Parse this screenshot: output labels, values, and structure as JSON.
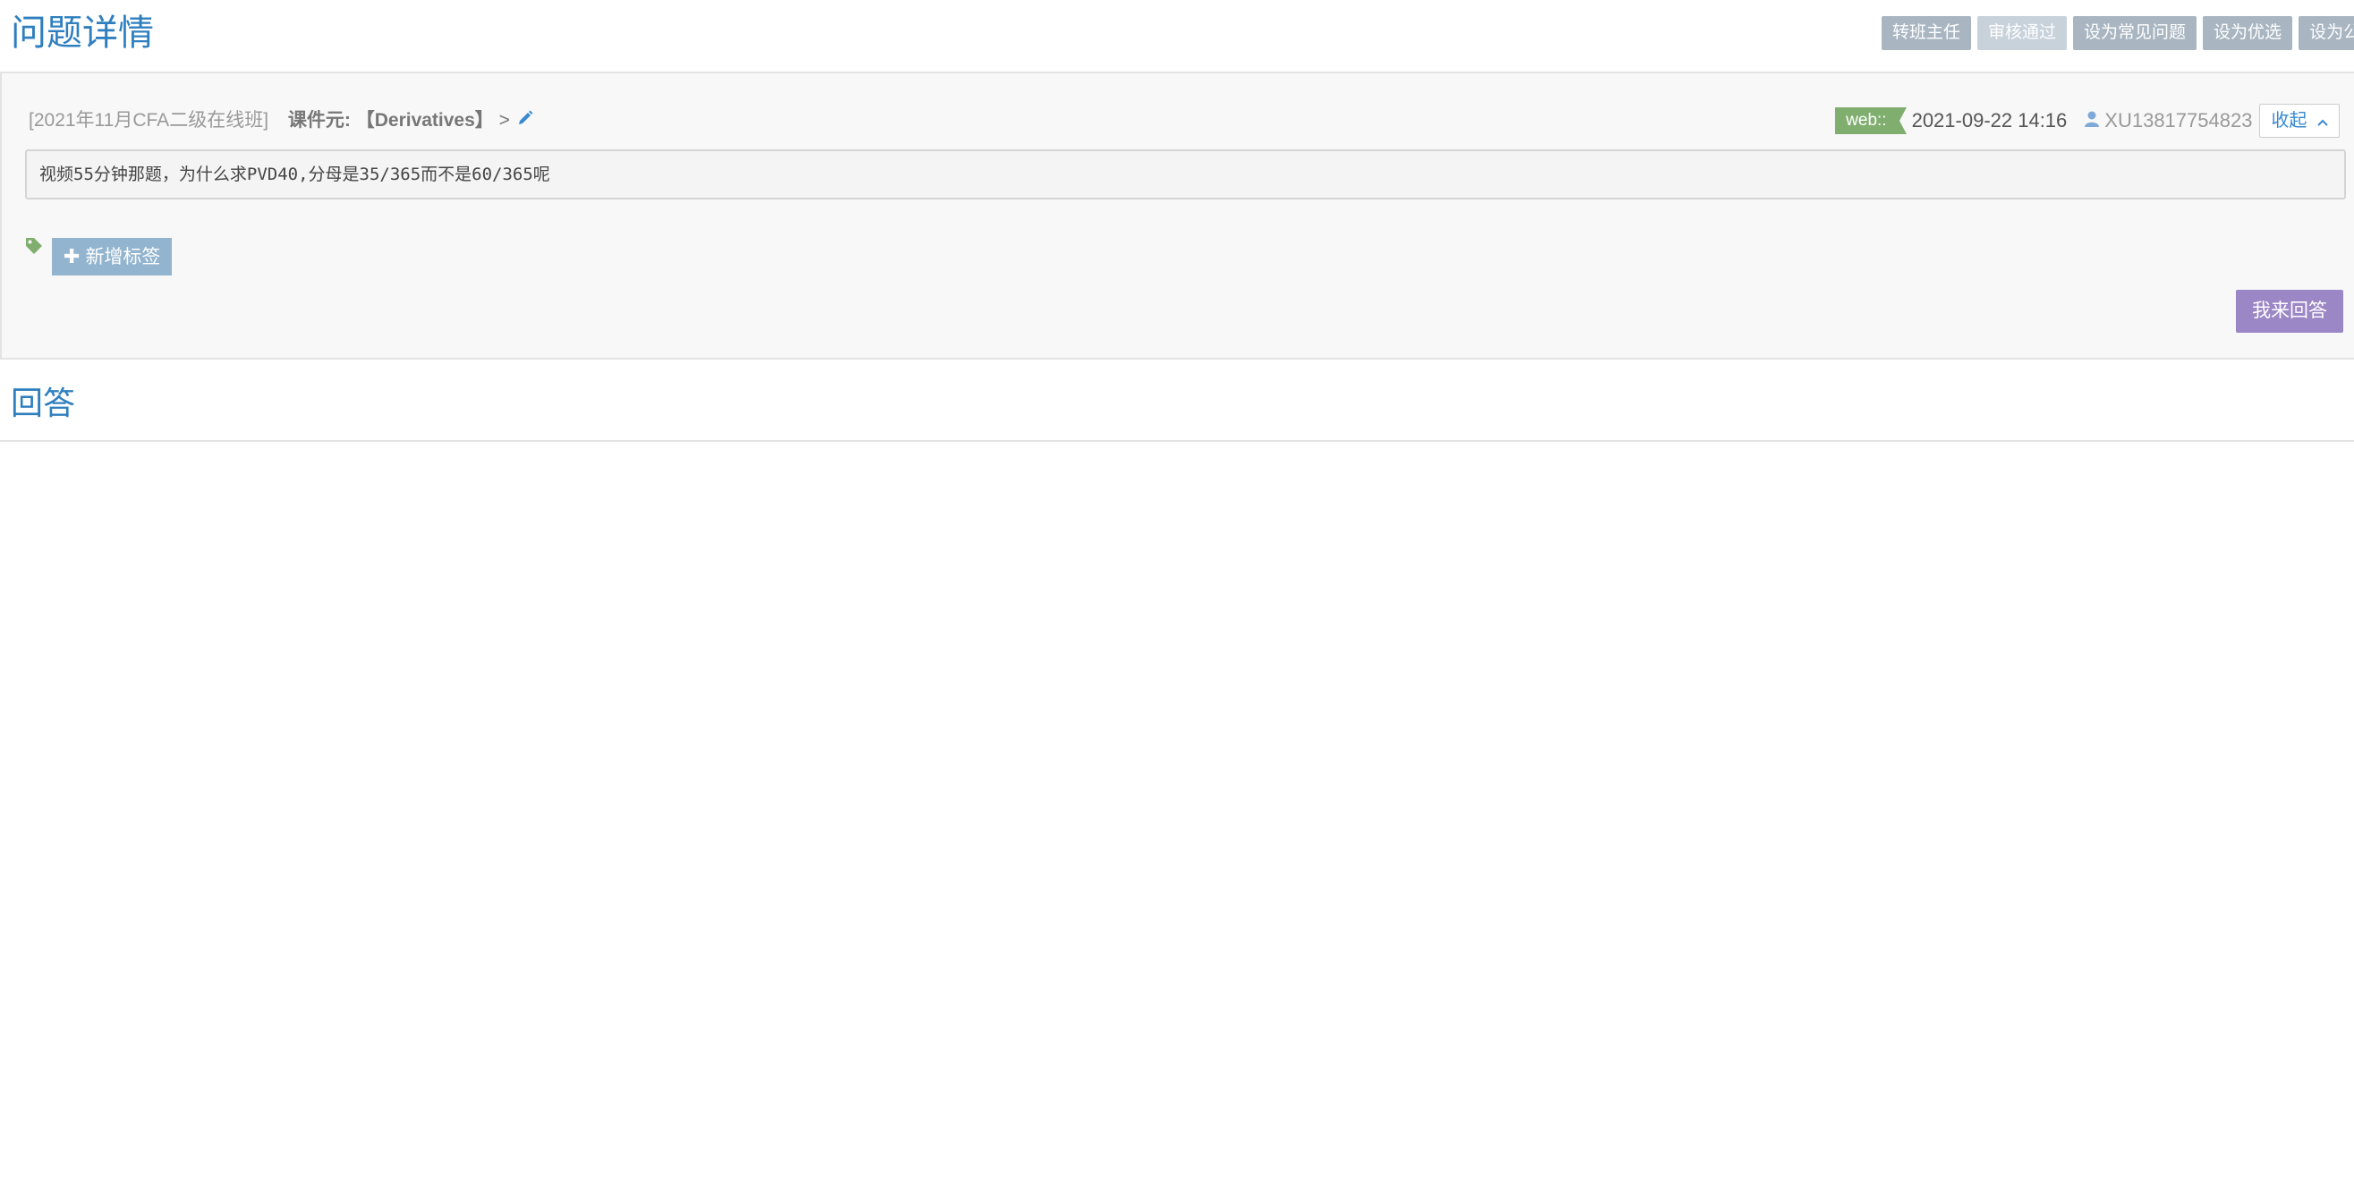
{
  "header": {
    "title": "问题详情",
    "actions": [
      {
        "label": "转班主任",
        "style": "normal"
      },
      {
        "label": "审核通过",
        "style": "light"
      },
      {
        "label": "设为常见问题",
        "style": "normal"
      },
      {
        "label": "设为优选",
        "style": "normal"
      },
      {
        "label": "设为公开",
        "style": "normal"
      }
    ]
  },
  "question": {
    "class_name": "[2021年11月CFA二级在线班]",
    "course_unit_label": "课件元:",
    "course_unit_value": "【Derivatives】",
    "course_unit_suffix": ">",
    "source_badge": "web::",
    "time": "2021-09-22 14:16",
    "user": "XU13817754823",
    "collapse_label": "收起",
    "body": "视频55分钟那题，为什么求PVD40,分母是35/365而不是60/365呢",
    "add_tag_label": "新增标签",
    "answer_button": "我来回答"
  },
  "answers": {
    "title": "回答"
  },
  "colors": {
    "accent": "#2f7fbf",
    "toolbar_button": "#a9b6c2",
    "badge_green": "#7fae6f",
    "tag_button": "#92b4cf",
    "answer_button": "#9b86c6"
  },
  "icons": [
    "edit-icon",
    "user-icon",
    "chevron-up-icon",
    "tag-icon",
    "plus-icon"
  ]
}
